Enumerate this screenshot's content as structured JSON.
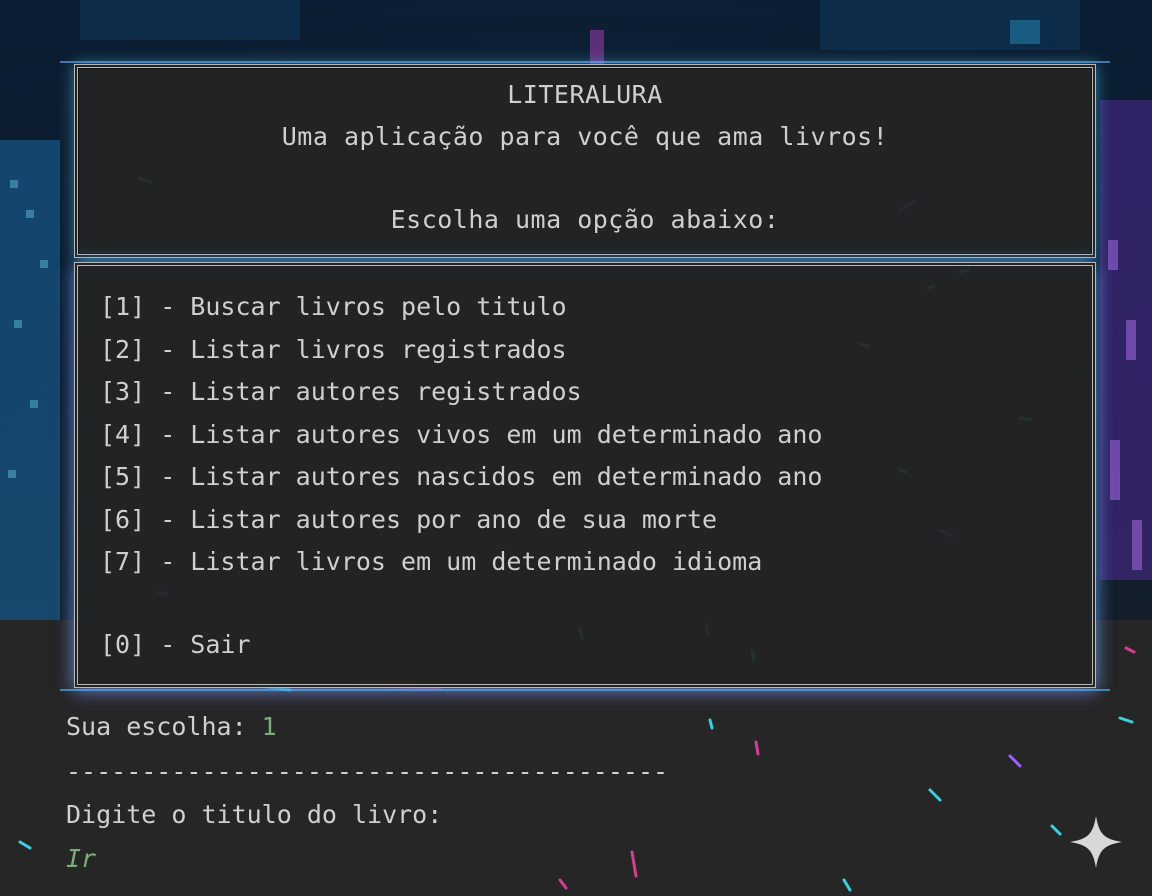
{
  "header": {
    "title": "LITERALURA",
    "subtitle": "Uma aplicação para você que ama livros!",
    "prompt": "Escolha uma opção abaixo:"
  },
  "menu": {
    "items": [
      {
        "label": "[1] - Buscar livros pelo titulo"
      },
      {
        "label": "[2] - Listar livros registrados"
      },
      {
        "label": "[3] - Listar autores registrados"
      },
      {
        "label": "[4] - Listar autores vivos em um determinado ano"
      },
      {
        "label": "[5] - Listar autores nascidos em determinado ano"
      },
      {
        "label": "[6] - Listar autores por ano de sua morte"
      },
      {
        "label": "[7] - Listar livros em um determinado idioma"
      }
    ],
    "exit_label": "[0] - Sair"
  },
  "console": {
    "choice_label": "Sua escolha: ",
    "choice_value": "1",
    "separator": "----------------------------------------",
    "title_prompt": "Digite o titulo do livro:",
    "title_input": "Ir"
  },
  "colors": {
    "background": "#262626",
    "text": "#cfcfcf",
    "input_green": "#7cae7a",
    "glow_cyan": "#50c8ff",
    "glow_purple": "#a06eff"
  },
  "icons": {
    "corner": "sparkle-icon"
  }
}
